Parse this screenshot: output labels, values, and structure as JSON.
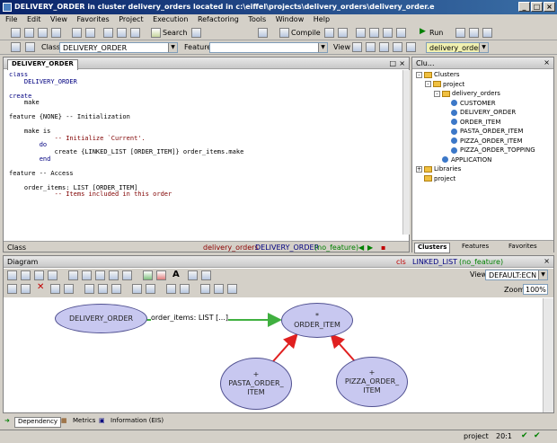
{
  "window": {
    "title": "DELIVERY_ORDER in cluster delivery_orders located in c:\\eiffel\\projects\\delivery_orders\\delivery_order.e",
    "minimize": "_",
    "maximize": "□",
    "close": "×"
  },
  "menu": [
    "File",
    "Edit",
    "View",
    "Favorites",
    "Project",
    "Execution",
    "Refactoring",
    "Tools",
    "Window",
    "Help"
  ],
  "toolbar1": {
    "search_label": "Search",
    "compile_label": "Compile",
    "run_label": "Run",
    "target_combo": "delivery_orders"
  },
  "toolbar2": {
    "class_label": "Class",
    "class_value": "DELIVERY_ORDER",
    "feature_label": "Feature",
    "feature_value": "",
    "view_label": "View"
  },
  "editor": {
    "tab": "DELIVERY_ORDER",
    "lines": [
      {
        "t": "class",
        "c": "kw"
      },
      {
        "t": "    DELIVERY_ORDER",
        "c": "kw"
      },
      {
        "t": "",
        "c": ""
      },
      {
        "t": "create",
        "c": "kw"
      },
      {
        "t": "    make",
        "c": ""
      },
      {
        "t": "",
        "c": ""
      },
      {
        "t": "feature {NONE} -- Initialization",
        "c": ""
      },
      {
        "t": "",
        "c": ""
      },
      {
        "t": "    make is",
        "c": ""
      },
      {
        "t": "            -- Initialize `Current'.",
        "c": "cm"
      },
      {
        "t": "        do",
        "c": "kw"
      },
      {
        "t": "            create {LINKED_LIST [ORDER_ITEM]} order_items.make",
        "c": ""
      },
      {
        "t": "        end",
        "c": "kw"
      },
      {
        "t": "",
        "c": ""
      },
      {
        "t": "feature -- Access",
        "c": ""
      },
      {
        "t": "",
        "c": ""
      },
      {
        "t": "    order_items: LIST [ORDER_ITEM]",
        "c": ""
      },
      {
        "t": "            -- Items included in this order",
        "c": "cm"
      }
    ],
    "status_class": "Class",
    "status_cluster": "delivery_orders",
    "status_name": "DELIVERY_ORDER",
    "status_feature": "(no_feature)"
  },
  "clusters": {
    "title": "Clu...",
    "tree": [
      {
        "label": "Clusters",
        "level": 0,
        "icon": "folder",
        "exp": "-"
      },
      {
        "label": "project",
        "level": 1,
        "icon": "folder",
        "exp": "-"
      },
      {
        "label": "delivery_orders",
        "level": 2,
        "icon": "folder",
        "exp": "-"
      },
      {
        "label": "CUSTOMER",
        "level": 3,
        "icon": "class",
        "exp": ""
      },
      {
        "label": "DELIVERY_ORDER",
        "level": 3,
        "icon": "class",
        "exp": ""
      },
      {
        "label": "ORDER_ITEM",
        "level": 3,
        "icon": "class",
        "exp": ""
      },
      {
        "label": "PASTA_ORDER_ITEM",
        "level": 3,
        "icon": "class",
        "exp": ""
      },
      {
        "label": "PIZZA_ORDER_ITEM",
        "level": 3,
        "icon": "class",
        "exp": ""
      },
      {
        "label": "PIZZA_ORDER_TOPPING",
        "level": 3,
        "icon": "class",
        "exp": ""
      },
      {
        "label": "APPLICATION",
        "level": 2,
        "icon": "class",
        "exp": ""
      },
      {
        "label": "Libraries",
        "level": 0,
        "icon": "folder",
        "exp": "+"
      },
      {
        "label": "project",
        "level": 0,
        "icon": "folder",
        "exp": ""
      }
    ],
    "tabs": [
      "Clusters",
      "Features",
      "Favorites"
    ]
  },
  "diagram": {
    "title": "Diagram",
    "status_cls": "cls",
    "status_name": "LINKED_LIST",
    "status_feature": "(no_feature)",
    "view_label": "View",
    "view_value": "DEFAULT:ECN",
    "zoom_label": "Zoom",
    "zoom_value": "100%",
    "nodes": [
      {
        "id": "delivery",
        "lines": [
          "DELIVERY_ORDER"
        ]
      },
      {
        "id": "order_item",
        "lines": [
          "*",
          "ORDER_ITEM"
        ]
      },
      {
        "id": "pasta",
        "lines": [
          "+",
          "PASTA_ORDER_",
          "ITEM"
        ]
      },
      {
        "id": "pizza",
        "lines": [
          "+",
          "PIZZA_ORDER_",
          "ITEM"
        ]
      }
    ],
    "client_label": "order_items: LIST [...]"
  },
  "bottom_tabs": [
    "Dependency",
    "Metrics",
    "Information (EIS)"
  ],
  "statusbar": {
    "project": "project",
    "position": "20:1"
  }
}
